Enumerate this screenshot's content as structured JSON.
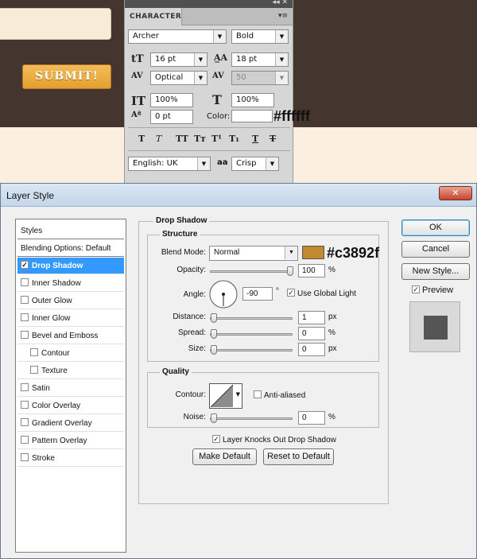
{
  "canvas": {
    "submit_label": "SUBMIT!",
    "text_color_label": "#ffffff",
    "colors": {
      "dark_band": "#44362e",
      "cream": "#fbf0df",
      "button": "#e7a63b"
    }
  },
  "character_panel": {
    "tab_title": "CHARACTER",
    "font_family": "Archer",
    "font_style": "Bold",
    "font_size": "16 pt",
    "leading": "18 pt",
    "kerning": "Optical",
    "tracking": "50",
    "vertical_scale": "100%",
    "horizontal_scale": "100%",
    "baseline_shift": "0 pt",
    "color_label": "Color:",
    "color_value": "#ffffff",
    "type_buttons": [
      "T",
      "T",
      "TT",
      "Tт",
      "T¹",
      "T₁",
      "T",
      "T"
    ],
    "language": "English: UK",
    "antialias_icon": "aa",
    "antialias": "Crisp"
  },
  "dialog": {
    "title": "Layer Style",
    "close_glyph": "✕",
    "styles": [
      {
        "label": "Styles",
        "checkbox": false,
        "checked": false,
        "selected": false,
        "header": true
      },
      {
        "label": "Blending Options: Default",
        "checkbox": false,
        "checked": false,
        "selected": false,
        "header": true
      },
      {
        "label": "Drop Shadow",
        "checkbox": true,
        "checked": true,
        "selected": true
      },
      {
        "label": "Inner Shadow",
        "checkbox": true,
        "checked": false,
        "selected": false
      },
      {
        "label": "Outer Glow",
        "checkbox": true,
        "checked": false,
        "selected": false
      },
      {
        "label": "Inner Glow",
        "checkbox": true,
        "checked": false,
        "selected": false
      },
      {
        "label": "Bevel and Emboss",
        "checkbox": true,
        "checked": false,
        "selected": false
      },
      {
        "label": "Contour",
        "checkbox": true,
        "checked": false,
        "selected": false,
        "sub": true
      },
      {
        "label": "Texture",
        "checkbox": true,
        "checked": false,
        "selected": false,
        "sub": true
      },
      {
        "label": "Satin",
        "checkbox": true,
        "checked": false,
        "selected": false
      },
      {
        "label": "Color Overlay",
        "checkbox": true,
        "checked": false,
        "selected": false
      },
      {
        "label": "Gradient Overlay",
        "checkbox": true,
        "checked": false,
        "selected": false
      },
      {
        "label": "Pattern Overlay",
        "checkbox": true,
        "checked": false,
        "selected": false
      },
      {
        "label": "Stroke",
        "checkbox": true,
        "checked": false,
        "selected": false
      }
    ],
    "drop_shadow": {
      "group_title": "Drop Shadow",
      "structure_title": "Structure",
      "blend_mode_label": "Blend Mode:",
      "blend_mode": "Normal",
      "shadow_color": "#c3892f",
      "shadow_color_label": "#c3892f",
      "opacity_label": "Opacity:",
      "opacity": "100",
      "opacity_fraction": 1.0,
      "angle_label": "Angle:",
      "angle": "-90",
      "degree_unit": "°",
      "use_global_light": "Use Global Light",
      "distance_label": "Distance:",
      "distance": "1",
      "spread_label": "Spread:",
      "spread": "0",
      "size_label": "Size:",
      "size": "0",
      "quality_title": "Quality",
      "contour_label": "Contour:",
      "anti_aliased": "Anti-aliased",
      "noise_label": "Noise:",
      "noise": "0",
      "layer_knocks_out": "Layer Knocks Out Drop Shadow",
      "make_default": "Make Default",
      "reset_default": "Reset to Default",
      "px": "px",
      "pct": "%"
    },
    "buttons": {
      "ok": "OK",
      "cancel": "Cancel",
      "new_style": "New Style...",
      "preview": "Preview"
    },
    "check_glyph": "✓"
  }
}
